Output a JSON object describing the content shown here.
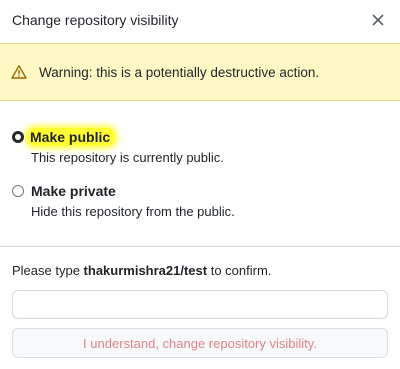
{
  "dialog": {
    "title": "Change repository visibility",
    "close_icon": "close-icon"
  },
  "warning": {
    "icon": "alert-icon",
    "text": "Warning: this is a potentially destructive action."
  },
  "options": [
    {
      "label": "Make public",
      "description": "This repository is currently public.",
      "checked": true,
      "highlighted": true
    },
    {
      "label": "Make private",
      "description": "Hide this repository from the public.",
      "checked": false
    }
  ],
  "confirm": {
    "prefix": "Please type ",
    "repo": "thakurmishra21/test",
    "suffix": " to confirm.",
    "input_value": "",
    "button_label": "I understand, change repository visibility.",
    "button_disabled": true
  },
  "colors": {
    "warning_bg": "#fff8c5",
    "highlight": "#ffff33",
    "danger_text": "#e0828a"
  }
}
